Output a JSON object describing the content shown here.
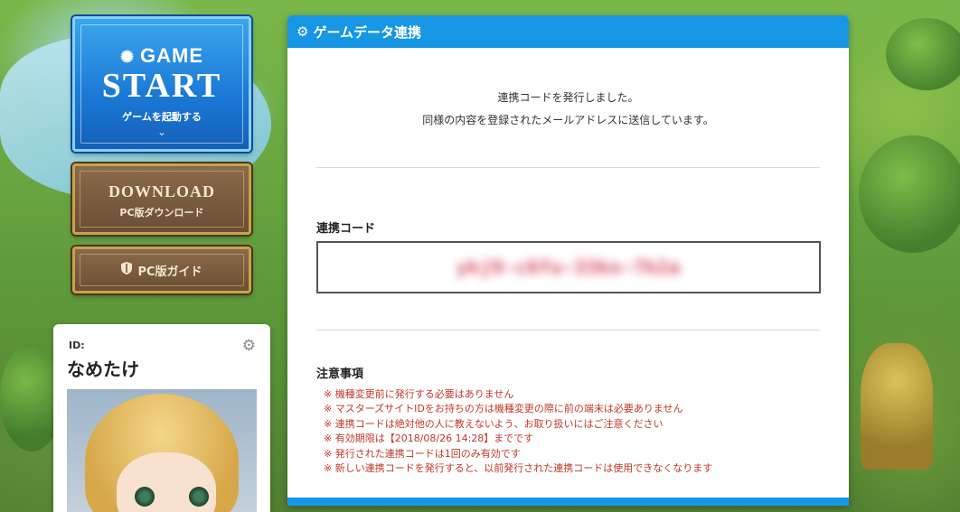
{
  "sidebar": {
    "start_button": {
      "game": "GAME",
      "start": "START",
      "sub": "ゲームを起動する",
      "chevron_icon": "chevron-down-icon"
    },
    "download_button": {
      "title": "DOWNLOAD",
      "sub": "PC版ダウンロード"
    },
    "guide_button": {
      "label": "PC版ガイド",
      "icon": "shield-icon"
    },
    "profile": {
      "id_label": "ID:",
      "name": "なめたけ",
      "settings_icon": "gear-icon"
    }
  },
  "panel": {
    "title": "ゲームデータ連携",
    "title_icon": "gear-icon",
    "message_line1": "連携コードを発行しました。",
    "message_line2": "同様の内容を登録されたメールアドレスに送信しています。",
    "code_label": "連携コード",
    "code_value": "ykj9-c6fu-33kn-7h2a",
    "notes_title": "注意事項",
    "notes": [
      "※ 機種変更前に発行する必要はありません",
      "※ マスターズサイトIDをお持ちの方は機種変更の際に前の端末は必要ありません",
      "※ 連携コードは絶対他の人に教えないよう、お取り扱いにはご注意ください",
      "※ 有効期限は【2018/08/26 14:28】までです",
      "※ 発行された連携コードは1回のみ有効です",
      "※ 新しい連携コードを発行すると、以前発行された連携コードは使用できなくなります"
    ]
  },
  "colors": {
    "header_blue": "#1796e6",
    "notes_red": "#c0392b",
    "start_blue": "#1b78d6",
    "brown_button": "#6b4e34"
  }
}
